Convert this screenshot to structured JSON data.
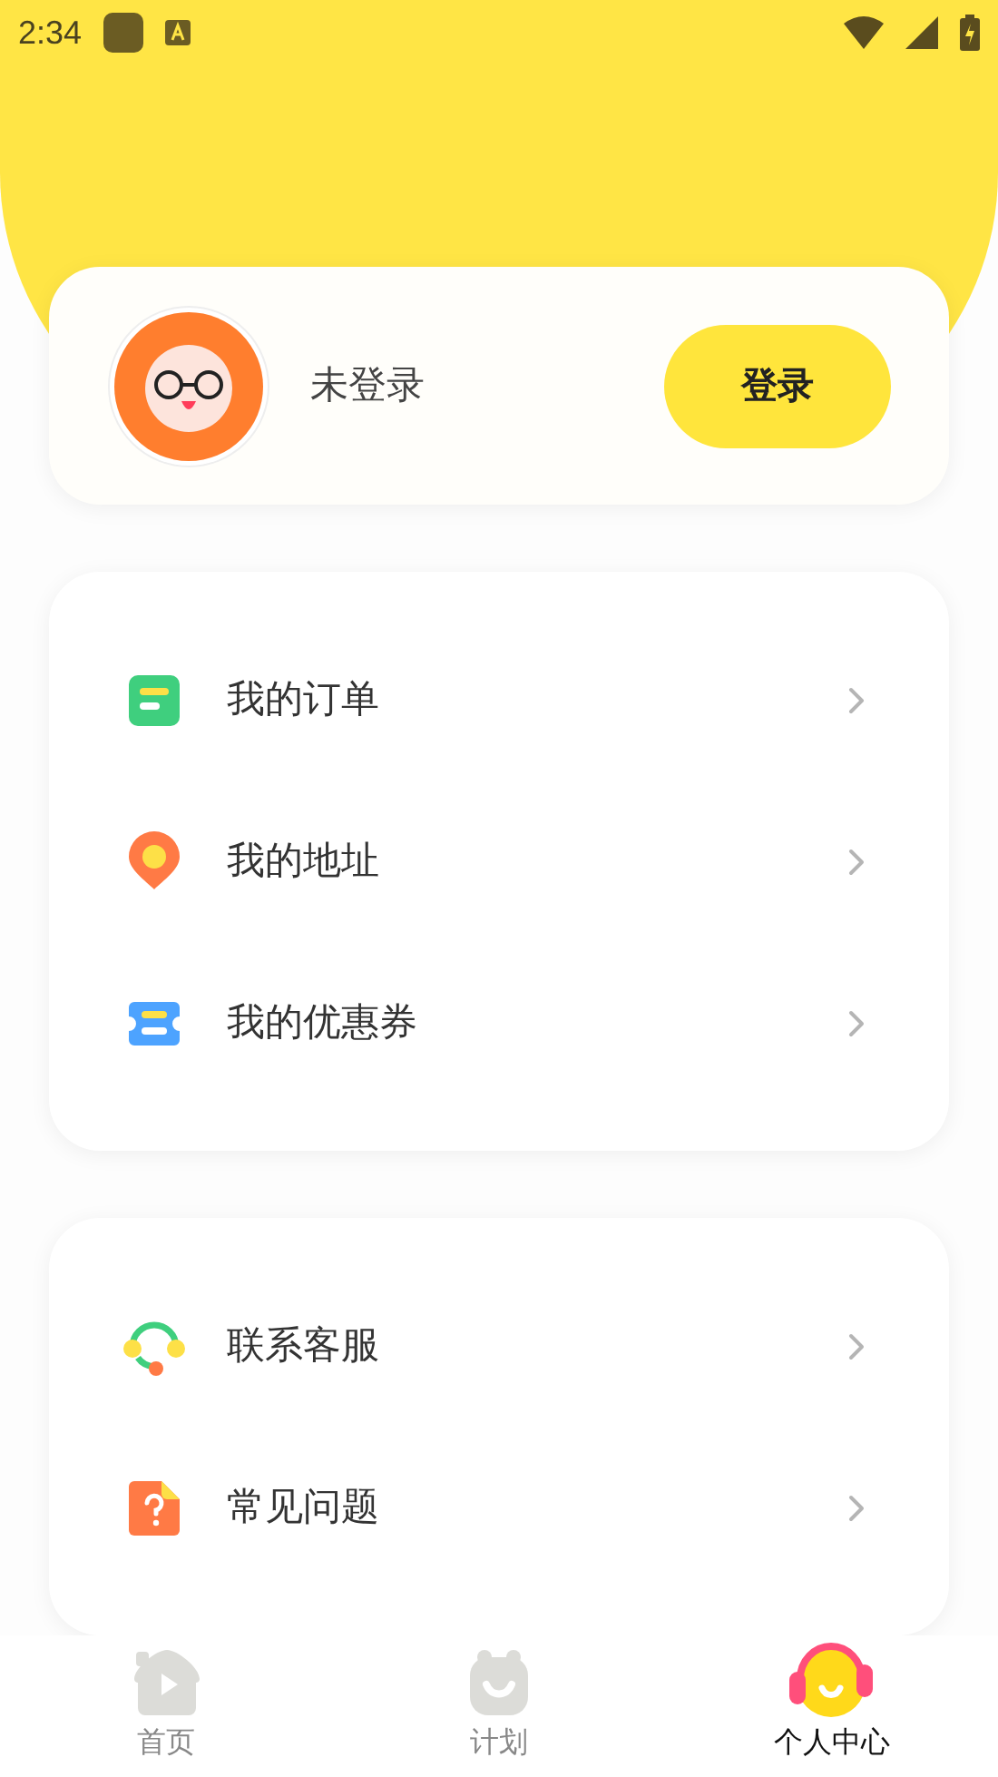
{
  "status_bar": {
    "time": "2:34"
  },
  "profile": {
    "name": "未登录",
    "login_button": "登录"
  },
  "menu_groups": [
    {
      "items": [
        {
          "kind": "order",
          "label": "我的订单"
        },
        {
          "kind": "address",
          "label": "我的地址"
        },
        {
          "kind": "coupon",
          "label": "我的优惠券"
        }
      ]
    },
    {
      "items": [
        {
          "kind": "service",
          "label": "联系客服"
        },
        {
          "kind": "faq",
          "label": "常见问题"
        }
      ]
    }
  ],
  "tab_bar": [
    {
      "kind": "home",
      "label": "首页",
      "selected": false
    },
    {
      "kind": "plan",
      "label": "计划",
      "selected": false
    },
    {
      "kind": "me",
      "label": "个人中心",
      "selected": true
    }
  ]
}
